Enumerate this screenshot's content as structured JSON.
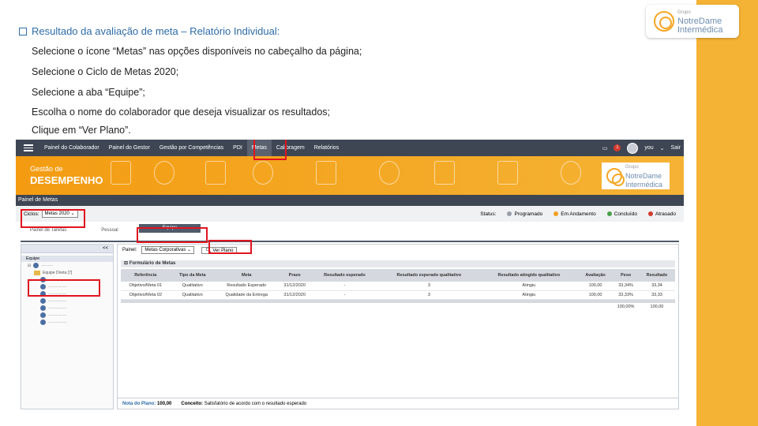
{
  "heading": "Resultado da avaliação de meta – Relatório Individual:",
  "steps": [
    "Selecione o ícone “Metas” nas opções disponíveis no cabeçalho da página;",
    "Selecione o Ciclo de Metas 2020;",
    "Selecione a aba “Equipe”;",
    "Escolha o nome do colaborador que deseja visualizar os resultados;",
    "Clique em “Ver Plano”."
  ],
  "logo": {
    "group": "Grupo",
    "name1": "NotreDame",
    "name2": "Intermédica"
  },
  "navbar": {
    "items": [
      "Painel do Colaborador",
      "Painel do Gestor",
      "Gestão por Competências",
      "PDI",
      "Metas",
      "Calibragem",
      "Relatórios"
    ],
    "active": "Metas",
    "badge": "1",
    "user": "you",
    "logout": "Sair"
  },
  "banner": {
    "line1": "Gestão de",
    "line2": "DESEMPENHO"
  },
  "painel_title": "Painel de Metas",
  "ciclo": {
    "label": "Ciclos:",
    "value": "Metas 2020"
  },
  "status": {
    "label": "Status:",
    "items": [
      {
        "label": "Programado",
        "color": "#9aa0a8"
      },
      {
        "label": "Em Andamento",
        "color": "#f0a020"
      },
      {
        "label": "Concluído",
        "color": "#4aa04a"
      },
      {
        "label": "Atrasado",
        "color": "#d23a2f"
      }
    ]
  },
  "tabs": [
    "Painel de Tarefas",
    "Pessoal",
    "Equipe"
  ],
  "left_panel": {
    "collapse": "<<",
    "subheader": "Equipe",
    "team": "Equipe Direta [7]"
  },
  "main_panel": {
    "painel_label": "Painel:",
    "painel_value": "Metas Corporativas",
    "ver_plano": "Ver Plano",
    "form_title": "Formulário de Metas",
    "columns": [
      "Referência",
      "Tipo da Meta",
      "Meta",
      "Prazo",
      "Resultado esperado",
      "Resultado esperado qualitativo",
      "Resultado atingido qualitativo",
      "Avaliação",
      "Peso",
      "Resultado"
    ],
    "rows": [
      [
        "Objetivo/Meta 01",
        "Qualitativo",
        "Resultado Esperado",
        "31/12/2020",
        "-",
        "3",
        "Atingiu",
        "100,00",
        "33,34%",
        "33,34"
      ],
      [
        "Objetivo/Meta 02",
        "Qualitativo",
        "Qualidade da Entrega",
        "31/12/2020",
        "-",
        "3",
        "Atingiu",
        "100,00",
        "33,33%",
        "33,33"
      ]
    ],
    "totals": [
      "100,00%",
      "100,00"
    ],
    "footer_label": "Nota do Plano:",
    "footer_value": "100,00",
    "concept_label": "Conceito:",
    "concept_value": "Satisfatório de acordo com o resultado esperado"
  },
  "accent": "#f5b335",
  "highlight": "#e0141e"
}
